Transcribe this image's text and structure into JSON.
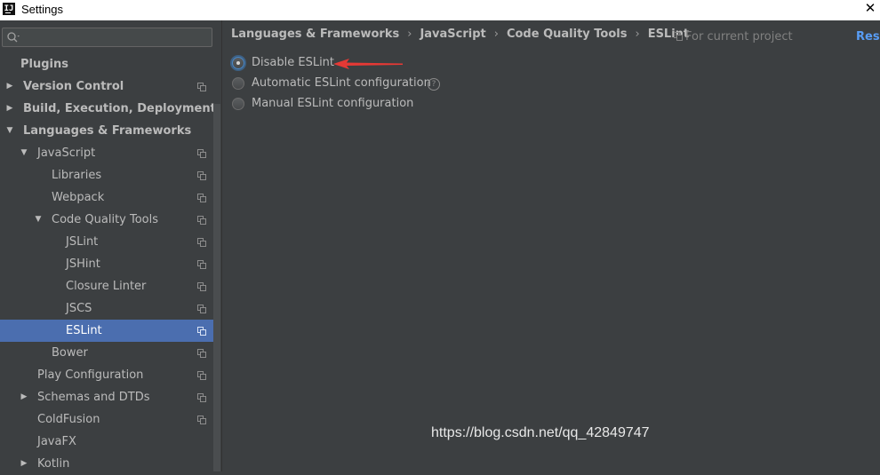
{
  "window": {
    "title": "Settings",
    "app_icon_text": "IJ",
    "close_glyph": "✕"
  },
  "search": {
    "value": "",
    "placeholder": ""
  },
  "tree": [
    {
      "label": "Plugins",
      "bold": true,
      "depth": 0,
      "arrow": "",
      "copy_icon": false
    },
    {
      "label": "Version Control",
      "bold": true,
      "depth": 0,
      "arrow": "right",
      "copy_icon": true
    },
    {
      "label": "Build, Execution, Deployment",
      "bold": true,
      "depth": 0,
      "arrow": "right",
      "copy_icon": false
    },
    {
      "label": "Languages & Frameworks",
      "bold": true,
      "depth": 0,
      "arrow": "down",
      "copy_icon": false
    },
    {
      "label": "JavaScript",
      "bold": false,
      "depth": 1,
      "arrow": "down",
      "copy_icon": true
    },
    {
      "label": "Libraries",
      "bold": false,
      "depth": 2,
      "arrow": "",
      "copy_icon": true
    },
    {
      "label": "Webpack",
      "bold": false,
      "depth": 2,
      "arrow": "",
      "copy_icon": true
    },
    {
      "label": "Code Quality Tools",
      "bold": false,
      "depth": 2,
      "arrow": "down",
      "copy_icon": true
    },
    {
      "label": "JSLint",
      "bold": false,
      "depth": 3,
      "arrow": "",
      "copy_icon": true
    },
    {
      "label": "JSHint",
      "bold": false,
      "depth": 3,
      "arrow": "",
      "copy_icon": true
    },
    {
      "label": "Closure Linter",
      "bold": false,
      "depth": 3,
      "arrow": "",
      "copy_icon": true
    },
    {
      "label": "JSCS",
      "bold": false,
      "depth": 3,
      "arrow": "",
      "copy_icon": true
    },
    {
      "label": "ESLint",
      "bold": false,
      "depth": 3,
      "arrow": "",
      "copy_icon": true,
      "selected": true
    },
    {
      "label": "Bower",
      "bold": false,
      "depth": 2,
      "arrow": "",
      "copy_icon": true
    },
    {
      "label": "Play Configuration",
      "bold": false,
      "depth": 1,
      "arrow": "",
      "copy_icon": true
    },
    {
      "label": "Schemas and DTDs",
      "bold": false,
      "depth": 1,
      "arrow": "right",
      "copy_icon": true
    },
    {
      "label": "ColdFusion",
      "bold": false,
      "depth": 1,
      "arrow": "",
      "copy_icon": true
    },
    {
      "label": "JavaFX",
      "bold": false,
      "depth": 1,
      "arrow": "",
      "copy_icon": false
    },
    {
      "label": "Kotlin",
      "bold": false,
      "depth": 1,
      "arrow": "right",
      "copy_icon": false
    }
  ],
  "breadcrumb": {
    "items": [
      "Languages & Frameworks",
      "JavaScript",
      "Code Quality Tools",
      "ESLint"
    ],
    "separator": "›"
  },
  "scope_label": "For current project",
  "reset_label": "Rese",
  "options": [
    {
      "label": "Disable ESLint",
      "checked": true,
      "help": false
    },
    {
      "label": "Automatic ESLint configuration",
      "checked": false,
      "help": true
    },
    {
      "label": "Manual ESLint configuration",
      "checked": false,
      "help": false
    }
  ],
  "help_glyph": "?",
  "watermark": "https://blog.csdn.net/qq_42849747",
  "colors": {
    "background": "#3c3f41",
    "selection": "#4b6eaf",
    "link": "#589df6",
    "annotation_arrow": "#e53935"
  }
}
